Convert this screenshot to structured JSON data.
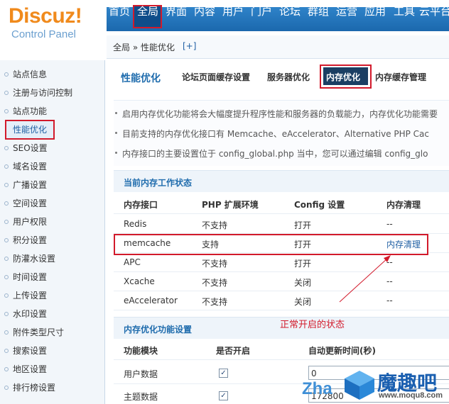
{
  "logo": {
    "main": "Discuz!",
    "sub": "Control Panel"
  },
  "topnav": {
    "items": [
      "首页",
      "全局",
      "界面",
      "内容",
      "用户",
      "门户",
      "论坛",
      "群组",
      "运营",
      "应用",
      "工具",
      "云平台"
    ],
    "active": "全局"
  },
  "breadcrumb": {
    "path": "全局 » 性能优化",
    "add": "[+]"
  },
  "sidebar": {
    "items": [
      "站点信息",
      "注册与访问控制",
      "站点功能",
      "性能优化",
      "SEO设置",
      "域名设置",
      "广播设置",
      "空间设置",
      "用户权限",
      "积分设置",
      "防灌水设置",
      "时间设置",
      "上传设置",
      "水印设置",
      "附件类型尺寸",
      "搜索设置",
      "地区设置",
      "排行榜设置"
    ],
    "active": "性能优化"
  },
  "main": {
    "title": "性能优化",
    "subtabs": [
      "论坛页面缓存设置",
      "服务器优化",
      "内存优化",
      "内存缓存管理"
    ],
    "active_subtab": "内存优化",
    "tips": [
      "启用内存优化功能将会大幅度提升程序性能和服务器的负载能力，内存优化功能需要",
      "目前支持的内存优化接口有 Memcache、eAccelerator、Alternative PHP Cac",
      "内存接口的主要设置位于 config_global.php 当中，您可以通过编辑 config_glo"
    ],
    "status_section": {
      "title": "当前内存工作状态",
      "columns": [
        "内存接口",
        "PHP 扩展环境",
        "Config 设置",
        "内存清理"
      ],
      "rows": [
        [
          "Redis",
          "不支持",
          "打开",
          "--"
        ],
        [
          "memcache",
          "支持",
          "打开",
          "内存清理"
        ],
        [
          "APC",
          "不支持",
          "打开",
          "--"
        ],
        [
          "Xcache",
          "不支持",
          "关闭",
          "--"
        ],
        [
          "eAccelerator",
          "不支持",
          "关闭",
          "--"
        ]
      ]
    },
    "annotation": "正常开启的状态",
    "func_section": {
      "title": "内存优化功能设置",
      "columns": [
        "功能模块",
        "是否开启",
        "自动更新时间(秒)"
      ],
      "rows": [
        {
          "name": "用户数据",
          "enabled": true,
          "value": "0"
        },
        {
          "name": "主题数据",
          "enabled": true,
          "value": "172800"
        }
      ]
    }
  },
  "watermark": {
    "left": "Zha",
    "brand": "魔趣吧",
    "url": "www.moqu8.com"
  },
  "colors": {
    "nav": "#1b68ad",
    "accent": "#1f6cad",
    "highlight": "#d21a2b",
    "logo": "#f08a1c"
  }
}
